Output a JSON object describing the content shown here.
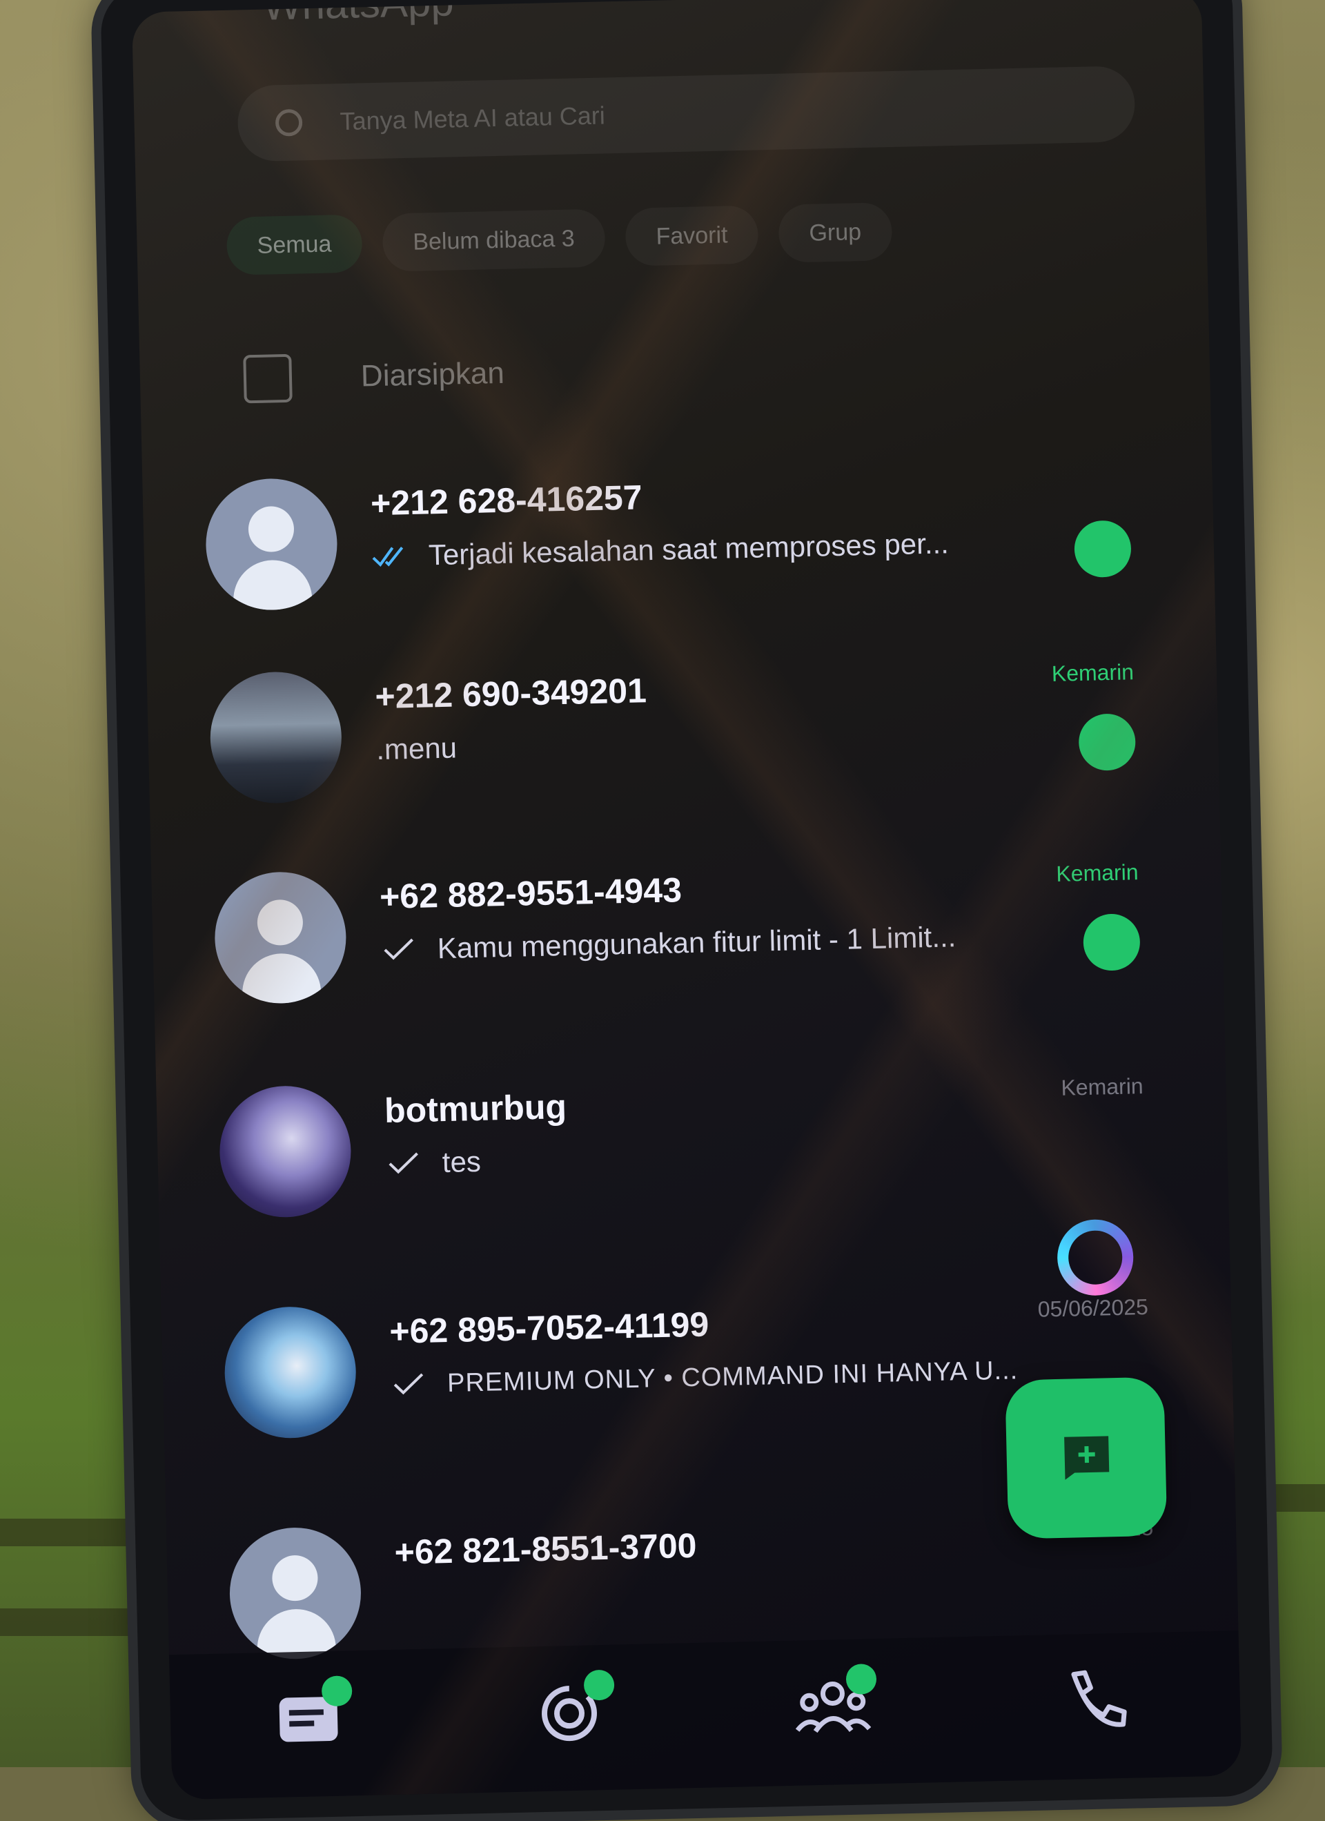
{
  "app": {
    "title": "WhatsApp"
  },
  "search": {
    "placeholder": "Tanya Meta AI atau Cari"
  },
  "filters": [
    {
      "label": "Semua"
    },
    {
      "label": "Belum dibaca 3"
    },
    {
      "label": "Favorit"
    },
    {
      "label": "Grup"
    }
  ],
  "archived": {
    "label": "Diarsipkan"
  },
  "chats": [
    {
      "name": "+212 628-416257",
      "message": "Terjadi kesalahan saat memproses per...",
      "time": "",
      "receipt": "double-blue"
    },
    {
      "name": "+212 690-349201",
      "message": ".menu",
      "time": "Kemarin",
      "receipt": "none"
    },
    {
      "name": "+62 882-9551-4943",
      "message": "Kamu menggunakan fitur limit - 1 Limit...",
      "time": "Kemarin",
      "receipt": "single"
    },
    {
      "name": "botmurbug",
      "message": "tes",
      "time": "Kemarin",
      "receipt": "single"
    },
    {
      "name": "+62 895-7052-41199",
      "message": "PREMIUM ONLY • COMMAND INI HANYA U...",
      "time": "05/06/2025",
      "receipt": "single"
    },
    {
      "name": "+62 821-8551-3700",
      "message": "",
      "time": "05/06/2025",
      "receipt": "none"
    }
  ],
  "nav": [
    {
      "icon": "chats-icon"
    },
    {
      "icon": "updates-icon"
    },
    {
      "icon": "communities-icon"
    },
    {
      "icon": "calls-icon"
    }
  ],
  "colors": {
    "accent": "#22c46a",
    "read_tick": "#4fb6ff",
    "background": "#0c0b14"
  }
}
